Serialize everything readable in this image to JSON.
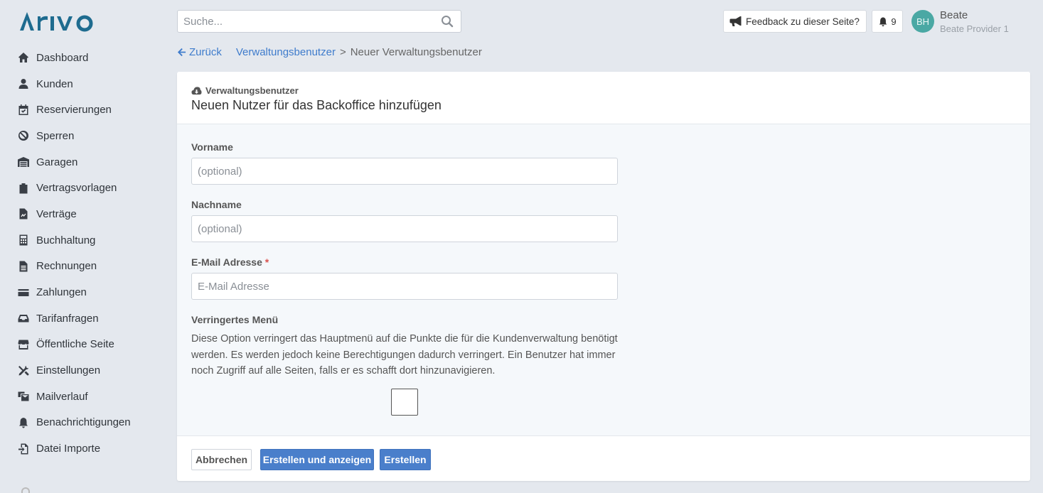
{
  "brand": {
    "logo_text": "ARIVO"
  },
  "sidebar": {
    "items": [
      {
        "label": "Dashboard",
        "icon": "home-icon"
      },
      {
        "label": "Kunden",
        "icon": "user-icon"
      },
      {
        "label": "Reservierungen",
        "icon": "calendar-check-icon"
      },
      {
        "label": "Sperren",
        "icon": "ban-icon"
      },
      {
        "label": "Garagen",
        "icon": "warehouse-icon"
      },
      {
        "label": "Vertragsvorlagen",
        "icon": "clipboard-icon"
      },
      {
        "label": "Verträge",
        "icon": "file-signature-icon"
      },
      {
        "label": "Buchhaltung",
        "icon": "calculator-icon"
      },
      {
        "label": "Rechnungen",
        "icon": "file-invoice-icon"
      },
      {
        "label": "Zahlungen",
        "icon": "credit-card-icon"
      },
      {
        "label": "Tarifanfragen",
        "icon": "inbox-icon"
      },
      {
        "label": "Öffentliche Seite",
        "icon": "store-icon"
      },
      {
        "label": "Einstellungen",
        "icon": "tools-icon"
      },
      {
        "label": "Mailverlauf",
        "icon": "mail-bulk-icon"
      },
      {
        "label": "Benachrichtigungen",
        "icon": "bell-icon"
      },
      {
        "label": "Datei Importe",
        "icon": "file-import-icon"
      }
    ]
  },
  "header": {
    "search_placeholder": "Suche...",
    "feedback_label": "Feedback zu dieser Seite?",
    "notification_count": "9",
    "user": {
      "initials": "BH",
      "name": "Beate",
      "org": "Beate Provider 1"
    }
  },
  "breadcrumb": {
    "back_label": "Zurück",
    "parent": "Verwaltungsbenutzer",
    "separator": ">",
    "current": "Neuer Verwaltungsbenutzer"
  },
  "card": {
    "eyebrow": "Verwaltungsbenutzer",
    "title": "Neuen Nutzer für das Backoffice hinzufügen"
  },
  "form": {
    "first_name": {
      "label": "Vorname",
      "placeholder": "(optional)",
      "value": ""
    },
    "last_name": {
      "label": "Nachname",
      "placeholder": "(optional)",
      "value": ""
    },
    "email": {
      "label": "E-Mail Adresse",
      "required_mark": "*",
      "placeholder": "E-Mail Adresse",
      "value": ""
    },
    "reduced_menu": {
      "label": "Verringertes Menü",
      "help": "Diese Option verringert das Hauptmenü auf die Punkte die für die Kundenverwaltung benötigt werden. Es werden jedoch keine Berechtigungen dadurch verringert. Ein Benutzer hat immer noch Zugriff auf alle Seiten, falls er es schafft dort hinzunavigieren.",
      "checked": false
    }
  },
  "actions": {
    "cancel_label": "Abbrechen",
    "create_show_label": "Erstellen und anzeigen",
    "create_label": "Erstellen"
  },
  "colors": {
    "accent": "#4a7fcb",
    "logo": "#1e6b8f",
    "avatar": "#4aa8a4",
    "required": "#d9534f"
  }
}
